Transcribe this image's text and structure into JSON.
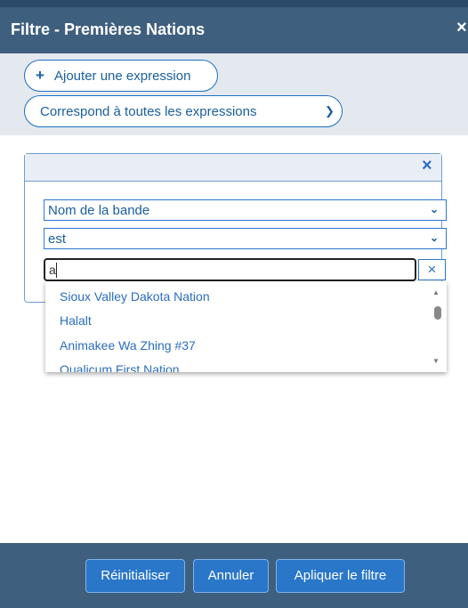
{
  "dialog": {
    "title": "Filtre - Premières Nations",
    "close_glyph": "×"
  },
  "toolbar": {
    "add_expression_label": "Ajouter une expression",
    "add_icon": "+",
    "match_mode": "Correspond à toutes les expressions"
  },
  "expression": {
    "remove_glyph": "×",
    "field": "Nom de la bande",
    "operator": "est",
    "search_value": "a",
    "clear_glyph": "×"
  },
  "suggestions": [
    "Sioux Valley Dakota Nation",
    "Halalt",
    "Animakee Wa Zhing #37",
    "Qualicum First Nation"
  ],
  "footer": {
    "reset_label": "Réinitialiser",
    "cancel_label": "Annuler",
    "apply_label": "Apliquer le filtre"
  },
  "colors": {
    "header": "#3f5f7f",
    "accent": "#2a76c9",
    "link": "#1a5fa0"
  }
}
